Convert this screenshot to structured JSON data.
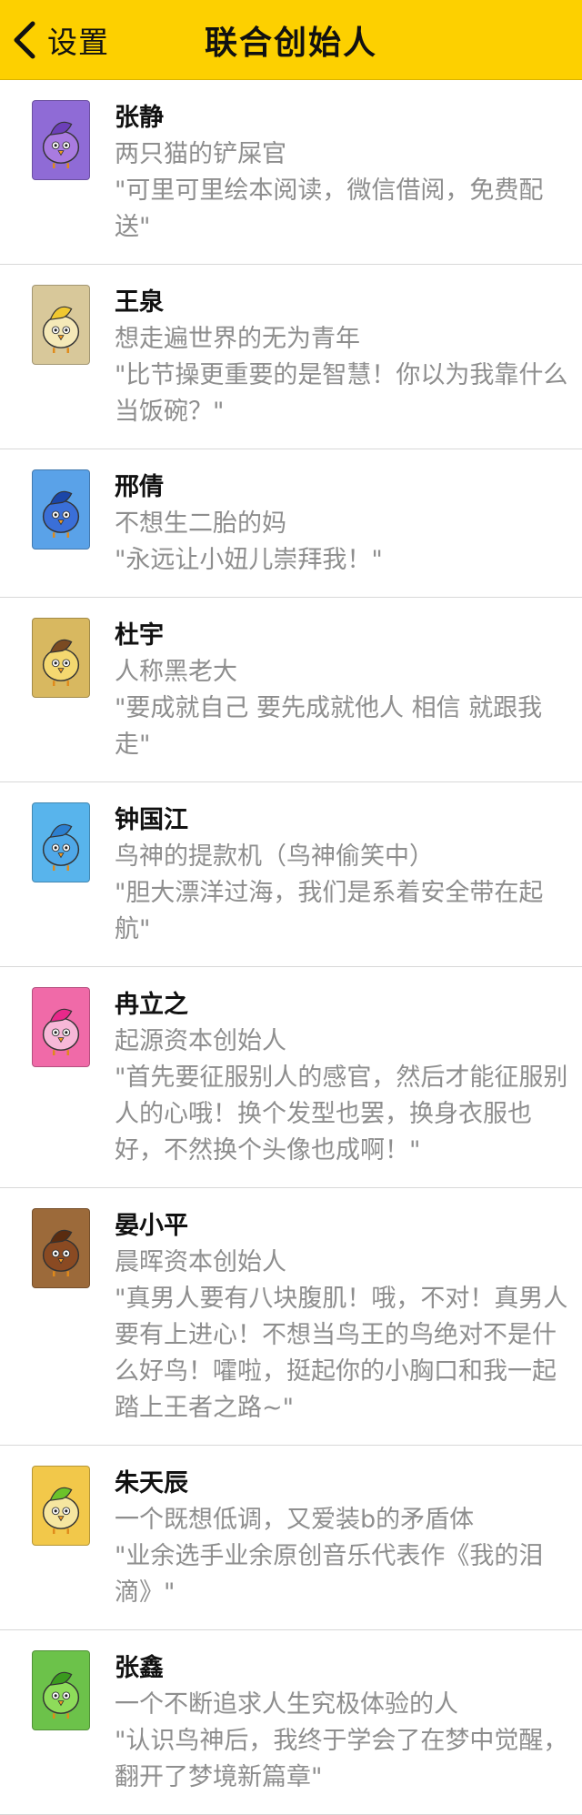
{
  "nav": {
    "back_label": "设置",
    "title": "联合创始人",
    "background": "#fdd000"
  },
  "founders": [
    {
      "name": "张静",
      "title": "两只猫的铲屎官",
      "quote": "\"可里可里绘本阅读，微信借阅，免费配送\"",
      "avatar_bg": "#8f6bd6",
      "bird": "#a97be0",
      "crest": "#6c3fb8"
    },
    {
      "name": "王泉",
      "title": "想走遍世界的无为青年",
      "quote": "\"比节操更重要的是智慧！你以为我靠什么当饭碗？\"",
      "avatar_bg": "#d8c89a",
      "bird": "#f5e9b8",
      "crest": "#f0c830"
    },
    {
      "name": "邢倩",
      "title": "不想生二胎的妈",
      "quote": "\"永远让小妞儿崇拜我！\"",
      "avatar_bg": "#5aa2e8",
      "bird": "#3a6fd8",
      "crest": "#1b46a8"
    },
    {
      "name": "杜宇",
      "title": "人称黑老大",
      "quote": "\"要成就自己 要先成就他人 相信 就跟我走\"",
      "avatar_bg": "#d8b860",
      "bird": "#f4d870",
      "crest": "#7a4a22"
    },
    {
      "name": "钟国江",
      "title": "鸟神的提款机（鸟神偷笑中）",
      "quote": "\"胆大漂洋过海，我们是系着安全带在起航\"",
      "avatar_bg": "#58b4ec",
      "bird": "#4fa8e8",
      "crest": "#2c7fd0"
    },
    {
      "name": "冉立之",
      "title": "起源资本创始人",
      "quote": "\"首先要征服别人的感官，然后才能征服别人的心哦！换个发型也罢，换身衣服也好，不然换个头像也成啊！\"",
      "avatar_bg": "#f06aa8",
      "bird": "#f7b8d8",
      "crest": "#e8288a"
    },
    {
      "name": "晏小平",
      "title": "晨晖资本创始人",
      "quote": "\"真男人要有八块腹肌！哦，不对！真男人要有上进心！不想当鸟王的鸟绝对不是什么好鸟！嚯啦，挺起你的小胸口和我一起踏上王者之路~\"",
      "avatar_bg": "#9c6a3a",
      "bird": "#8a4a22",
      "crest": "#5a2c10"
    },
    {
      "name": "朱天辰",
      "title": "一个既想低调，又爱装b的矛盾体",
      "quote": "\"业余选手业余原创音乐代表作《我的泪滴》\"",
      "avatar_bg": "#f2c84a",
      "bird": "#f6e6a0",
      "crest": "#6cc22a"
    },
    {
      "name": "张鑫",
      "title": "一个不断追求人生究极体验的人",
      "quote": "\"认识鸟神后，我终于学会了在梦中觉醒，翻开了梦境新篇章\"",
      "avatar_bg": "#6cc24a",
      "bird": "#8edc5a",
      "crest": "#3a9a1e"
    }
  ]
}
